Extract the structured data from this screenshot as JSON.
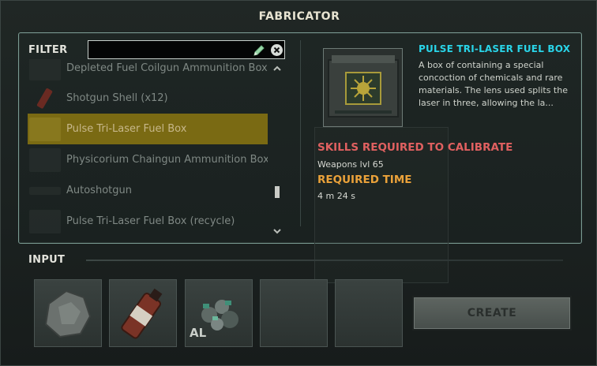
{
  "window": {
    "title": "FABRICATOR"
  },
  "filter": {
    "label": "FILTER",
    "value": ""
  },
  "list": {
    "items": [
      {
        "label": "Depleted Fuel Coilgun Ammunition Box (",
        "icon": "ammo-box-icon"
      },
      {
        "label": "Shotgun Shell (x12)",
        "icon": "shotgun-shell-icon"
      },
      {
        "label": "Pulse Tri-Laser Fuel Box",
        "icon": "fuel-box-icon",
        "selected": true
      },
      {
        "label": "Physicorium Chaingun Ammunition Box",
        "icon": "ammo-box-icon"
      },
      {
        "label": "Autoshotgun",
        "icon": "autoshotgun-icon"
      },
      {
        "label": "Pulse Tri-Laser Fuel Box (recycle)",
        "icon": "fuel-box-icon"
      }
    ]
  },
  "detail": {
    "title": "PULSE TRI-LASER FUEL BOX",
    "description": "A box of containing a special concoction of chemicals and rare materials. The lens used splits the laser in three, allowing the la...",
    "skills_heading": "SKILLS REQUIRED TO CALIBRATE",
    "skills_value": "Weapons lvl 65",
    "time_heading": "REQUIRED TIME",
    "time_value": "4 m 24 s"
  },
  "input": {
    "label": "INPUT",
    "slots": [
      {
        "icon": "rock-icon"
      },
      {
        "icon": "fuel-bottle-icon"
      },
      {
        "icon": "ore-pile-icon",
        "tag": "AL"
      },
      {
        "icon": "empty-slot"
      },
      {
        "icon": "empty-slot"
      }
    ]
  },
  "create_button": {
    "label": "CREATE"
  },
  "colors": {
    "accent_cyan": "#29d4e8",
    "skills_red": "#e06060",
    "time_orange": "#eba23a",
    "selection_gold": "#7a6a13"
  }
}
